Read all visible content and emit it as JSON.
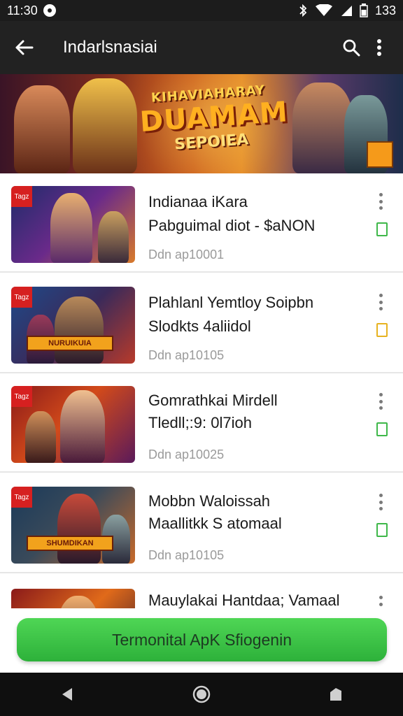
{
  "status_bar": {
    "time": "11:30",
    "battery": "133"
  },
  "app_bar": {
    "title": "Indarlsnasiai"
  },
  "banner": {
    "line1": "KIHAVIAHARAY",
    "line2": "DUAMAM",
    "line3": "SEPOIEA"
  },
  "items": [
    {
      "tag": "Tagz",
      "title": "Indianaa iKara",
      "subtitle": "Pabguimal diot - $aNON",
      "date": "Ddn ap10001",
      "check_color": "#3fb84a"
    },
    {
      "tag": "Tagz",
      "title": "Plahlanl Yemtloy Soipbn",
      "subtitle": "Slodkts 4aliidol",
      "date": "Ddn ap10105",
      "band": "NURUIKUIA",
      "check_color": "#e7b321"
    },
    {
      "tag": "Tagz",
      "title": "Gomrathkai Mirdell",
      "subtitle": "Tledll;:9: 0l7ioh",
      "date": "Ddn ap10025",
      "check_color": "#3fb84a"
    },
    {
      "tag": "Tagz",
      "title": "Mobbn Waloissah",
      "subtitle": "Maallitkk S atomaal",
      "date": "Ddn ap10105",
      "band": "SHUMDIKAN",
      "check_color": "#3fb84a"
    },
    {
      "title": "Mauylakai Hantdaa; Vamaal"
    }
  ],
  "cta": {
    "label": "Termonital ApK Sfiogenin"
  }
}
